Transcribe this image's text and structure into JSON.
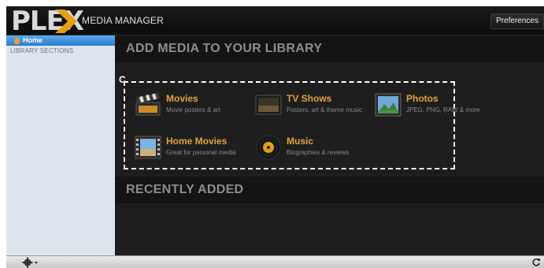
{
  "app": {
    "logo_text": "PLEX",
    "title": "MEDIA MANAGER",
    "preferences_label": "Preferences"
  },
  "sidebar": {
    "home_label": "Home",
    "sections_label": "LIBRARY SECTIONS"
  },
  "main": {
    "add_media_title": "ADD MEDIA TO YOUR LIBRARY",
    "recently_added_title": "RECENTLY ADDED",
    "annotation_label": "C",
    "media_types": [
      {
        "name": "Movies",
        "description": "Movie posters & art",
        "icon": "clapperboard-icon"
      },
      {
        "name": "TV Shows",
        "description": "Posters, art & theme music",
        "icon": "tv-icon"
      },
      {
        "name": "Photos",
        "description": "JPEG, PNG, RAW & more",
        "icon": "photo-icon"
      },
      {
        "name": "Home Movies",
        "description": "Great for personal media",
        "icon": "film-strip-icon"
      },
      {
        "name": "Music",
        "description": "Biographies & reviews",
        "icon": "vinyl-record-icon"
      }
    ]
  },
  "bottombar": {
    "settings_icon": "gear-icon",
    "refresh_icon": "refresh-icon"
  },
  "colors": {
    "accent_orange": "#e2a33a",
    "sidebar_selected": "#3d8fdd",
    "sidebar_bg": "#dde4ec"
  }
}
